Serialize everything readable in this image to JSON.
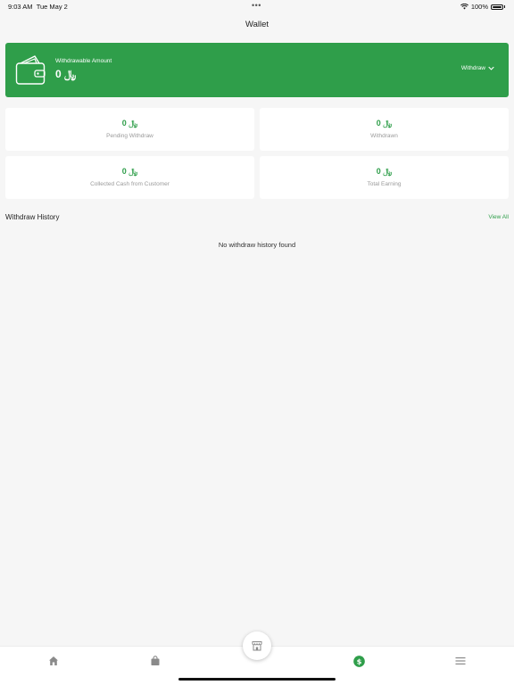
{
  "status_bar": {
    "time": "9:03 AM",
    "date": "Tue May 2",
    "battery": "100%"
  },
  "header": {
    "title": "Wallet"
  },
  "hero": {
    "label": "Withdrawable Amount",
    "amount": "0 ﷼",
    "withdraw_label": "Withdraw",
    "icon": "wallet-icon"
  },
  "stats": [
    {
      "value": "0 ﷼",
      "label": "Pending Withdraw"
    },
    {
      "value": "0 ﷼",
      "label": "Withdrawn"
    },
    {
      "value": "0 ﷼",
      "label": "Collected Cash from Customer"
    },
    {
      "value": "0 ﷼",
      "label": "Total Earning"
    }
  ],
  "history": {
    "title": "Withdraw History",
    "view_all": "View All",
    "empty": "No withdraw history found"
  },
  "bottom_nav": {
    "items": [
      "home-icon",
      "orders-bag-icon",
      "store-icon",
      "wallet-dollar-icon",
      "menu-icon"
    ],
    "active": "wallet-dollar-icon"
  },
  "colors": {
    "accent": "#2f9e4a",
    "background": "#f6f6f6",
    "muted_text": "#9a9a9a",
    "inactive_icon": "#8a8a8a"
  }
}
